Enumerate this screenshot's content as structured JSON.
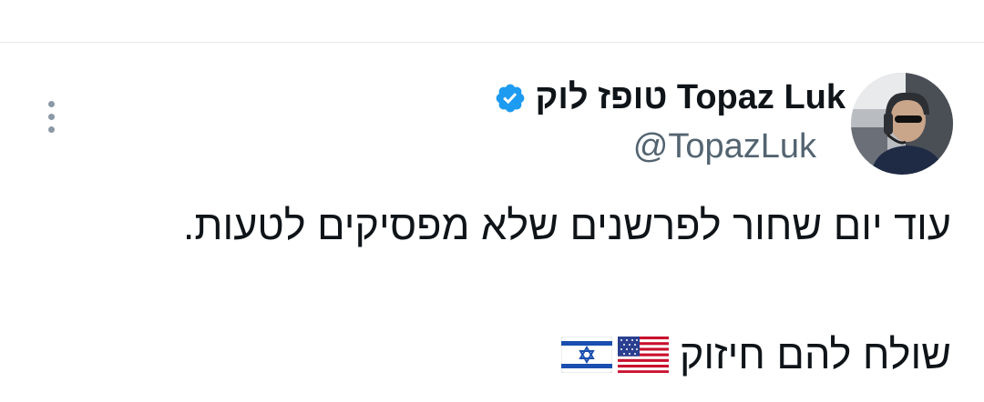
{
  "author": {
    "display_name": "טופז לוק Topaz Luk",
    "handle": "@TopazLuk",
    "verified": true,
    "avatar_icon": "profile-photo"
  },
  "tweet": {
    "text_line1": "עוד יום שחור לפרשנים שלא מפסיקים לטעות.",
    "text_line2": "שולח להם חיזוק",
    "emoji": [
      "us-flag-icon",
      "israel-flag-icon"
    ]
  },
  "colors": {
    "verified": "#1d9bf0",
    "handle": "#536471",
    "divider": "#e6e9eb"
  }
}
